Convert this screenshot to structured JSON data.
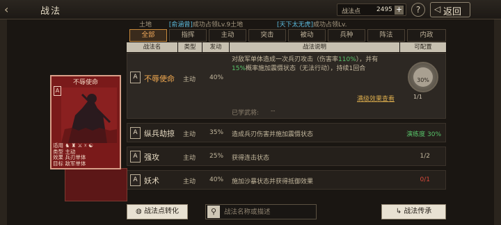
{
  "topbar": {
    "title": "战法",
    "points_label": "战法点",
    "points_value": "2495",
    "plus_label": "+",
    "help_label": "?",
    "return_label": "返回"
  },
  "info": {
    "left_tail": "土地",
    "left_name": "[俞涵曾]",
    "left_text": "成功占领Lv.9土地",
    "right_name": "[天下太无虎]",
    "right_text": "成功占领Lv."
  },
  "tabs": [
    "全部",
    "指挥",
    "主动",
    "突击",
    "被动",
    "兵种",
    "阵法",
    "内政"
  ],
  "header": [
    "战法名",
    "类型",
    "发动",
    "战法说明",
    "可配置"
  ],
  "selected_skill": {
    "badge": "A",
    "name": "不辱使命",
    "type": "主动",
    "rate": "40%",
    "desc_1": "对敌军单体造成一次兵刃攻击（伤害率",
    "desc_pct1": "110%",
    "desc_2": "），并有",
    "desc_pct2": "15%",
    "desc_3": "概率施加震慑状态（无法行动），持续1回合",
    "upgrade_link": "满级效果查看",
    "learned_label": "已学武将:",
    "learned_value": "--",
    "dial_pct": "30%",
    "dial_count": "1/1"
  },
  "skills": [
    {
      "badge": "A",
      "name": "纵兵劫掠",
      "type": "主动",
      "rate": "35%",
      "desc": "造成兵刃伤害并施加震慑状态",
      "rest": "演练度 30%"
    },
    {
      "badge": "A",
      "name": "强攻",
      "type": "主动",
      "rate": "25%",
      "desc": "获得连击状态",
      "rest": "1/2"
    },
    {
      "badge": "A",
      "name": "妖术",
      "type": "主动",
      "rate": "40%",
      "desc": "施加沙暴状态并获得抵御效果",
      "rest": "0/1"
    }
  ],
  "card": {
    "title": "不辱使命",
    "badge": "A",
    "info_label_1": "适用",
    "info_label_2": "类型",
    "info_value_2": "主动",
    "info_label_3": "效果",
    "info_value_3": "兵刃单体",
    "info_label_4": "目标",
    "info_value_4": "敌军单体"
  },
  "bottom": {
    "convert_label": "战法点转化",
    "search_placeholder": "战法名称或描述",
    "inherit_label": "战法传承"
  },
  "colors": {
    "accent_orange": "#f0a850",
    "link_gold": "#d6a94c",
    "ok_green": "#58c46a",
    "warn_red": "#d94a3c",
    "card_red": "#7a1a1a"
  }
}
